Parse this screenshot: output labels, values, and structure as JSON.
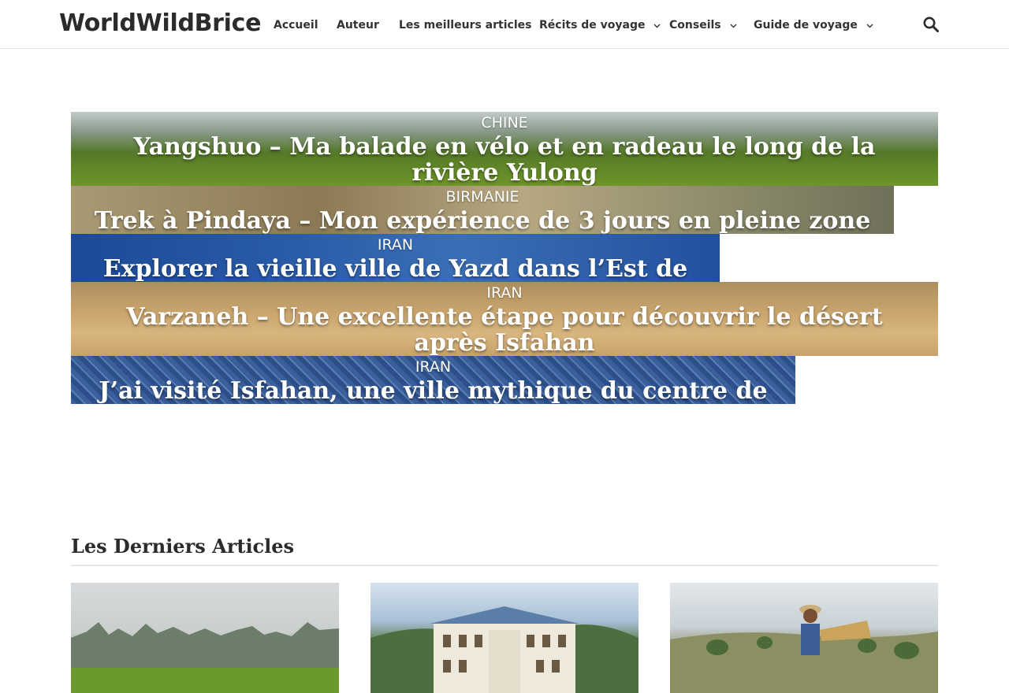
{
  "site": {
    "logo": "WorldWildBrice"
  },
  "nav": {
    "items": [
      {
        "label": "Accueil",
        "dropdown": false
      },
      {
        "label": "Auteur",
        "dropdown": false
      },
      {
        "label": "Les meilleurs articles",
        "dropdown": false
      },
      {
        "label": "Récits de voyage",
        "dropdown": true
      },
      {
        "label": "Conseils",
        "dropdown": true
      },
      {
        "label": "Guide de voyage",
        "dropdown": true
      }
    ],
    "search_icon": "search-icon"
  },
  "featured": [
    {
      "category": "CHINE",
      "title": "Yangshuo – Ma balade en vélo et en radeau le long de la rivière Yulong"
    },
    {
      "category": "BIRMANIE",
      "title": "Trek à Pindaya – Mon expérience de 3 jours en pleine zone Danu"
    },
    {
      "category": "IRAN",
      "title": "Explorer la vieille ville de Yazd dans l’Est de l’Iran"
    },
    {
      "category": "IRAN",
      "title": "Varzaneh – Une excellente étape pour découvrir le désert après Isfahan"
    },
    {
      "category": "IRAN",
      "title": "J’ai visité Isfahan, une ville mythique du centre de l’Iran"
    }
  ],
  "latest": {
    "heading": "Les Derniers Articles",
    "cards": [
      {
        "image": "karst-landscape-photo"
      },
      {
        "image": "colonial-building-photo"
      },
      {
        "image": "farmer-field-photo"
      }
    ]
  },
  "colors": {
    "text": "#2b2b2b",
    "nav_text": "#333333",
    "rule": "#e6e6e6"
  }
}
